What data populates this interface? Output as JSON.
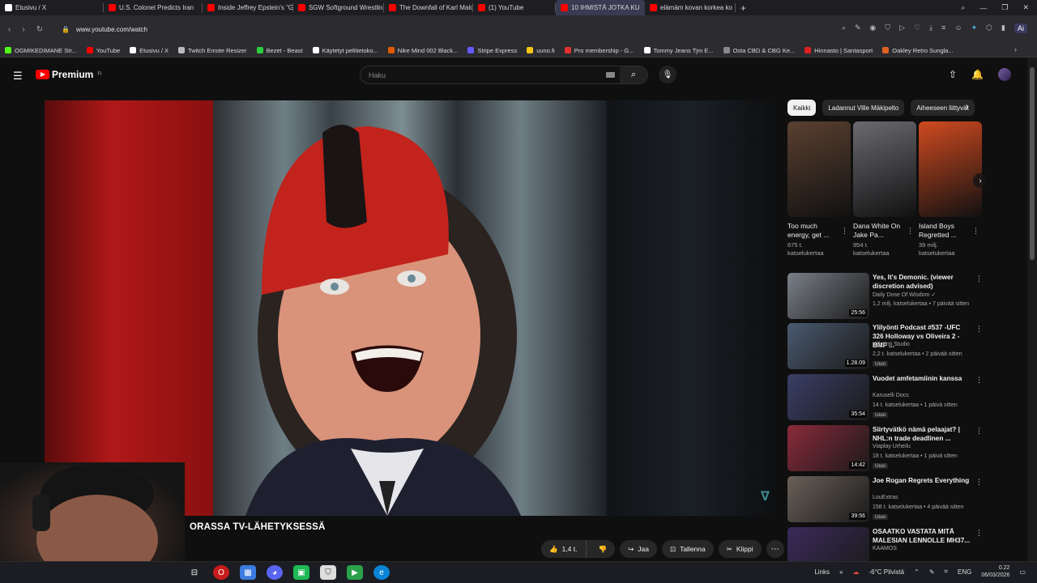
{
  "browser": {
    "tabs": [
      {
        "title": "Etusivu / X",
        "color": "#ffffff",
        "active": false
      },
      {
        "title": "U.S. Colonel Predicts Iran",
        "color": "#ff0000",
        "active": false
      },
      {
        "title": "Inside Jeffrey Epstein's \"Gi",
        "color": "#ff0000",
        "active": false
      },
      {
        "title": "SGW Softground Wrestlin",
        "color": "#ff0000",
        "active": false
      },
      {
        "title": "The Downfall of Karl Malo",
        "color": "#ff0000",
        "active": false
      },
      {
        "title": "(1) YouTube",
        "color": "#ff0000",
        "active": false
      },
      {
        "title": "10 IHMISTÄ JOTKA KU",
        "color": "#ff0000",
        "active": true
      },
      {
        "title": "elämäm kovan korkea ko",
        "color": "#ff0000",
        "active": false
      }
    ],
    "url": "www.youtube.com/watch",
    "ai_label": "Ai",
    "bookmarks": [
      {
        "label": "OGMIKEDIMANE Str...",
        "color": "#53fc18"
      },
      {
        "label": "YouTube",
        "color": "#ff0000"
      },
      {
        "label": "Etusivu / X",
        "color": "#ffffff"
      },
      {
        "label": "Twitch Emote Resizer",
        "color": "#bbbbbb"
      },
      {
        "label": "Bezet - Beast",
        "color": "#2ecc40"
      },
      {
        "label": "Käytetyt pelitietoko...",
        "color": "#ffffff"
      },
      {
        "label": "Nike Mind 002 Black...",
        "color": "#e05a00"
      },
      {
        "label": "Stripe Express",
        "color": "#635bff"
      },
      {
        "label": "uuno.fi",
        "color": "#f5c518"
      },
      {
        "label": "Pro membership - G...",
        "color": "#e03030"
      },
      {
        "label": "Tommy Jeans Tjm E...",
        "color": "#ffffff"
      },
      {
        "label": "Osta CBD & CBG Ke...",
        "color": "#888888"
      },
      {
        "label": "Hinnasto | Santasport",
        "color": "#e02020"
      },
      {
        "label": "Oakley Retro Sungla...",
        "color": "#e06020"
      }
    ]
  },
  "youtube": {
    "logo_text": "Premium",
    "logo_sup": "FI",
    "search_placeholder": "Haku",
    "video_title": "ORASSA TV-LÄHETYKSESSÄ",
    "actions": {
      "likes": "1,4 t.",
      "share": "Jaa",
      "save": "Tallenna",
      "clip": "Klippi"
    },
    "chips": [
      "Kaikki",
      "Ladannut Ville Mäkipelto",
      "Aiheeseen liittyvät"
    ],
    "shorts": [
      {
        "title": "Too much energy, get ...",
        "views": "675 t. katselukertaa",
        "color": "#5a4030"
      },
      {
        "title": "Dana White On Jake Pa...",
        "views": "954 t. katselukertaa",
        "color": "#6a6a70"
      },
      {
        "title": "Island Boys Regretted ...",
        "views": "39 milj. katselukertaa",
        "color": "#d04a20"
      }
    ],
    "recommendations": [
      {
        "title": "Yes, It's Demonic. (viewer discretion advised)",
        "channel": "Daily Dose Of Wisdom ✓",
        "meta": "1,2 milj. katselukertaa • 7 päivää sitten",
        "duration": "25:56",
        "badge": "",
        "color": "#7a7f88"
      },
      {
        "title": "Ylilyönti Podcast #537 -UFC 326 Holloway vs Oliveira 2 - BMF ...",
        "channel": "Ylilyönti Studio",
        "meta": "2,2 t. katselukertaa • 2 päivää sitten",
        "duration": "1.28.09",
        "badge": "Uusi",
        "color": "#4a5a70"
      },
      {
        "title": "Vuodet amfetamiinin kanssa",
        "channel": "Karuselli Docs",
        "meta": "14 t. katselukertaa • 1 päivä sitten",
        "duration": "35:54",
        "badge": "Uusi",
        "color": "#3a3f66"
      },
      {
        "title": "Siirtyvätkö nämä pelaajat? | NHL:n trade deadlinen ...",
        "channel": "Viaplay Urheilu",
        "meta": "18 t. katselukertaa • 1 päivä sitten",
        "duration": "14:42",
        "badge": "Uusi",
        "color": "#8a2a3a"
      },
      {
        "title": "Joe Rogan Regrets Everything",
        "channel": "LouExtras",
        "meta": "158 t. katselukertaa • 4 päivää sitten",
        "duration": "39:56",
        "badge": "Uusi",
        "color": "#6a6058"
      },
      {
        "title": "OSAATKO VASTATA MITÄ MALESIAN LENNOLLE MH37...",
        "channel": "KAAMOS",
        "meta": "",
        "duration": "",
        "badge": "",
        "color": "#3a2a5a"
      }
    ]
  },
  "taskbar": {
    "links": "Links",
    "weather": "-6°C Pilvistä",
    "lang": "ENG",
    "time": "0.22",
    "date": "06/03/2026"
  }
}
